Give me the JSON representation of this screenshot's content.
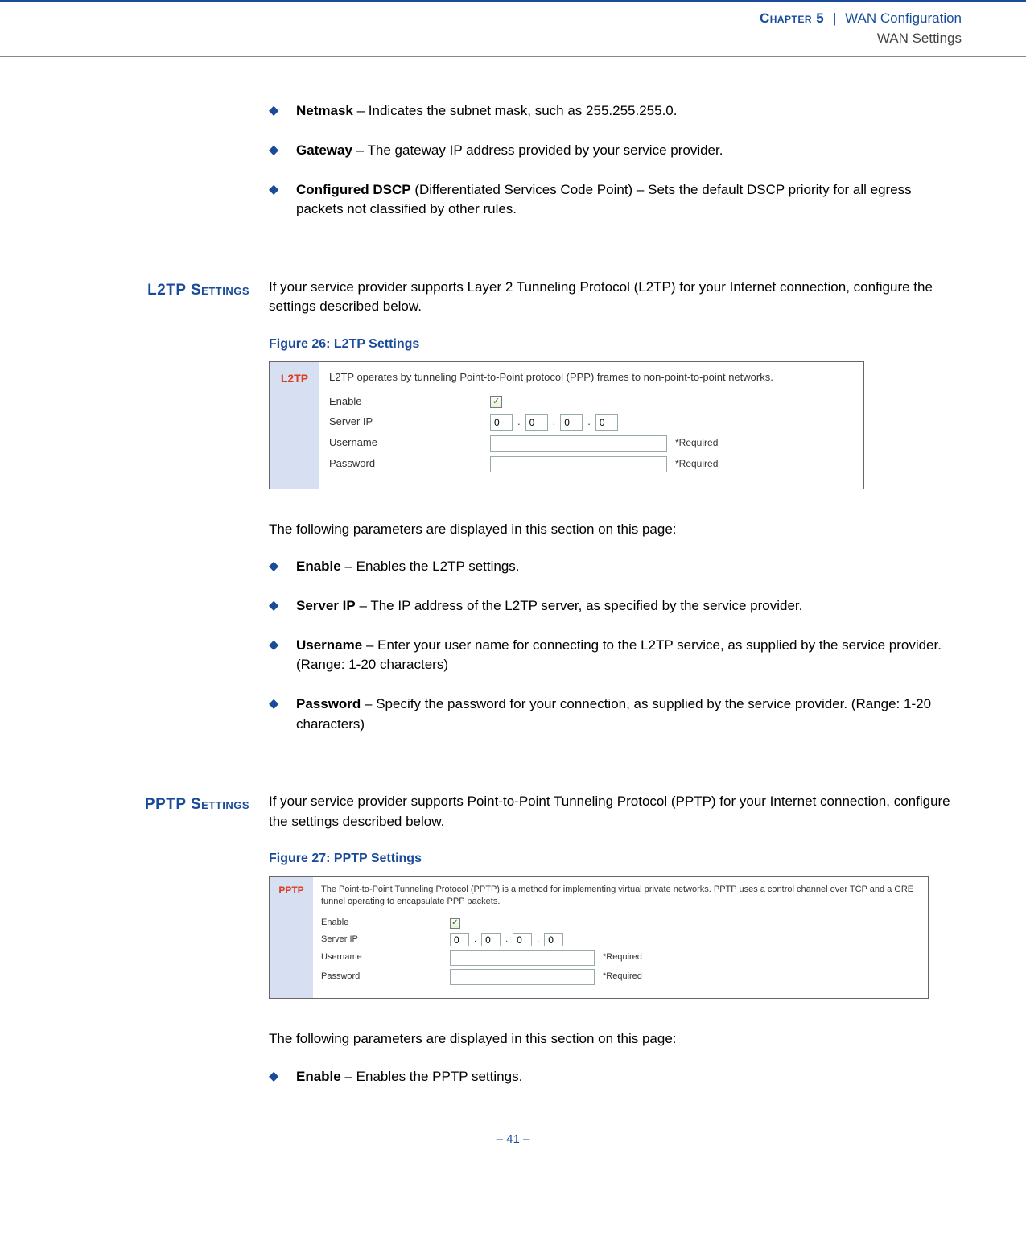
{
  "header": {
    "chapter_label": "Chapter 5",
    "sep": "|",
    "chapter_title": "WAN Configuration",
    "section_title": "WAN Settings"
  },
  "intro_bullets": [
    {
      "term": "Netmask",
      "rest": " – Indicates the subnet mask, such as 255.255.255.0."
    },
    {
      "term": "Gateway",
      "rest": " – The gateway IP address provided by your service provider."
    },
    {
      "term": "Configured DSCP",
      "rest": " (Differentiated Services Code Point) – Sets the default DSCP priority for all egress packets not classified by other rules."
    }
  ],
  "l2tp": {
    "heading": "L2TP Settings",
    "intro": "If your service provider supports Layer 2 Tunneling Protocol (L2TP) for your Internet connection, configure the settings described below.",
    "fig_caption": "Figure 26:  L2TP Settings",
    "panel": {
      "side_label": "L2TP",
      "description": "L2TP operates by tunneling Point-to-Point protocol (PPP) frames to non-point-to-point networks.",
      "rows": {
        "enable_label": "Enable",
        "enable_checked": "✓",
        "serverip_label": "Server IP",
        "ip": [
          "0",
          "0",
          "0",
          "0"
        ],
        "username_label": "Username",
        "username_value": "",
        "password_label": "Password",
        "password_value": "",
        "required": "*Required"
      }
    },
    "post_intro": "The following parameters are displayed in this section on this page:",
    "bullets": [
      {
        "term": "Enable",
        "rest": " – Enables the L2TP settings."
      },
      {
        "term": "Server IP",
        "rest": " – The IP address of the L2TP server, as specified by the service provider."
      },
      {
        "term": "Username",
        "rest": " – Enter your user name for connecting to the L2TP service, as supplied by the service provider. (Range: 1-20 characters)"
      },
      {
        "term": "Password",
        "rest": " – Specify the password for your connection, as supplied by the service provider. (Range: 1-20 characters)"
      }
    ]
  },
  "pptp": {
    "heading": "PPTP Settings",
    "intro": "If your service provider supports Point-to-Point Tunneling Protocol (PPTP) for your Internet connection, configure the settings described below.",
    "fig_caption": "Figure 27:  PPTP Settings",
    "panel": {
      "side_label": "PPTP",
      "description": "The Point-to-Point Tunneling Protocol (PPTP) is a method for implementing virtual private networks. PPTP uses a control channel over TCP and a GRE tunnel operating to encapsulate PPP packets.",
      "rows": {
        "enable_label": "Enable",
        "enable_checked": "✓",
        "serverip_label": "Server IP",
        "ip": [
          "0",
          "0",
          "0",
          "0"
        ],
        "username_label": "Username",
        "username_value": "",
        "password_label": "Password",
        "password_value": "",
        "required": "*Required"
      }
    },
    "post_intro": "The following parameters are displayed in this section on this page:",
    "bullets": [
      {
        "term": "Enable",
        "rest": " – Enables the PPTP settings."
      }
    ]
  },
  "footer": {
    "page": "–  41  –"
  }
}
